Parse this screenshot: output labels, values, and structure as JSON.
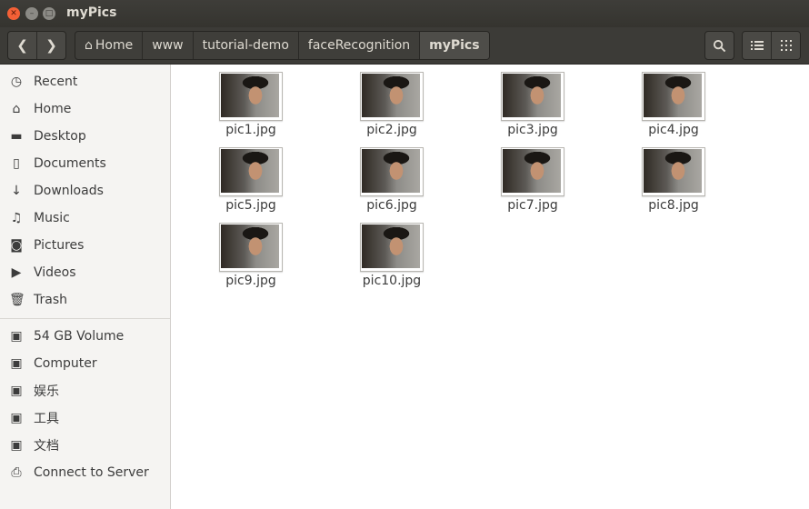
{
  "window": {
    "title": "myPics"
  },
  "toolbar": {
    "back_icon": "chevron-left-icon",
    "forward_icon": "chevron-right-icon",
    "breadcrumbs": [
      "Home",
      "www",
      "tutorial-demo",
      "faceRecognition",
      "myPics"
    ],
    "search_icon": "search-icon",
    "list_view_icon": "list-view-icon",
    "grid_view_icon": "grid-view-icon"
  },
  "sidebar": {
    "items": [
      {
        "label": "Recent",
        "icon": "clock-icon"
      },
      {
        "label": "Home",
        "icon": "home-icon"
      },
      {
        "label": "Desktop",
        "icon": "folder-icon"
      },
      {
        "label": "Documents",
        "icon": "document-icon"
      },
      {
        "label": "Downloads",
        "icon": "download-icon"
      },
      {
        "label": "Music",
        "icon": "music-icon"
      },
      {
        "label": "Pictures",
        "icon": "camera-icon"
      },
      {
        "label": "Videos",
        "icon": "video-icon"
      },
      {
        "label": "Trash",
        "icon": "trash-icon"
      }
    ],
    "devices": [
      {
        "label": "54 GB Volume",
        "icon": "drive-icon"
      },
      {
        "label": "Computer",
        "icon": "drive-icon"
      },
      {
        "label": "娱乐",
        "icon": "drive-icon"
      },
      {
        "label": "工具",
        "icon": "drive-icon"
      },
      {
        "label": "文档",
        "icon": "drive-icon"
      },
      {
        "label": "Connect to Server",
        "icon": "server-icon"
      }
    ]
  },
  "files": [
    "pic1.jpg",
    "pic2.jpg",
    "pic3.jpg",
    "pic4.jpg",
    "pic5.jpg",
    "pic6.jpg",
    "pic7.jpg",
    "pic8.jpg",
    "pic9.jpg",
    "pic10.jpg"
  ],
  "colors": {
    "titlebar": "#3e3d39",
    "close_button": "#f46036",
    "sidebar_bg": "#f5f4f2"
  }
}
